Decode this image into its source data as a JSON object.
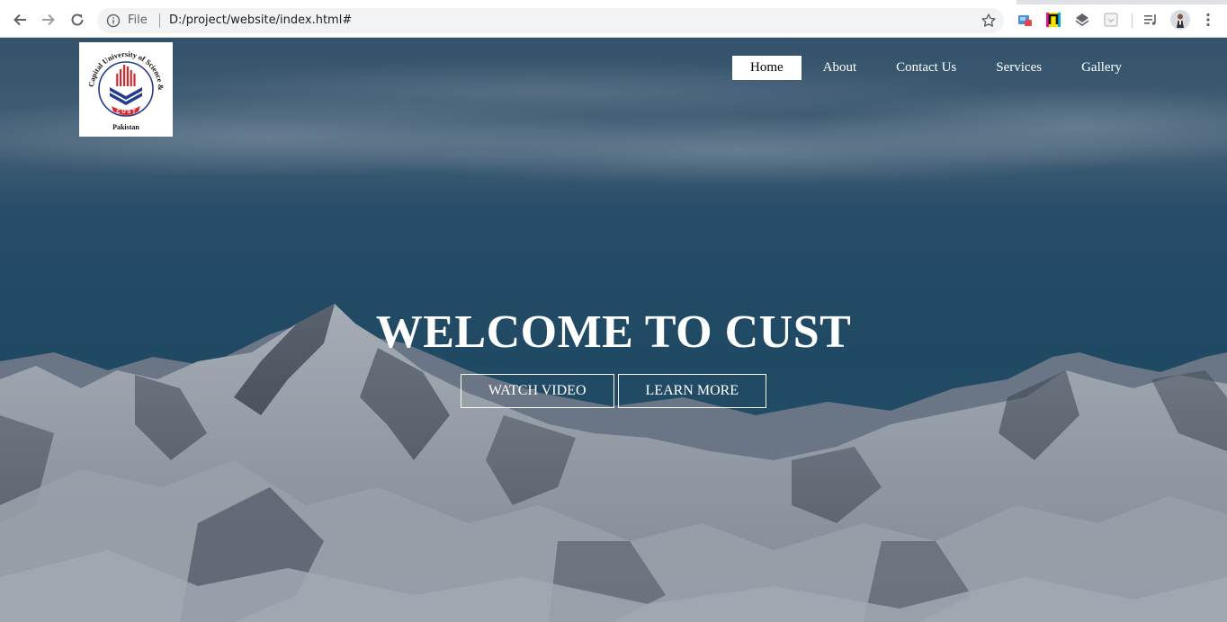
{
  "browser": {
    "address_scheme": "File",
    "address_url": "D:/project/website/index.html#"
  },
  "nav": {
    "items": [
      {
        "label": "Home",
        "active": true
      },
      {
        "label": "About",
        "active": false
      },
      {
        "label": "Contact Us",
        "active": false
      },
      {
        "label": "Services",
        "active": false
      },
      {
        "label": "Gallery",
        "active": false
      }
    ]
  },
  "logo": {
    "ring_text": "Capital University of Science & Technology",
    "bottom_text": "Pakistan",
    "badge_text": "C U S T"
  },
  "hero": {
    "title": "WELCOME TO CUST",
    "buttons": [
      "WATCH VIDEO",
      "LEARN MORE"
    ]
  },
  "colors": {
    "sky": "#2a5573",
    "snow": "#c9d0d8",
    "nav_active_bg": "#ffffff",
    "logo_red": "#d6282f",
    "logo_blue": "#243b8e"
  }
}
